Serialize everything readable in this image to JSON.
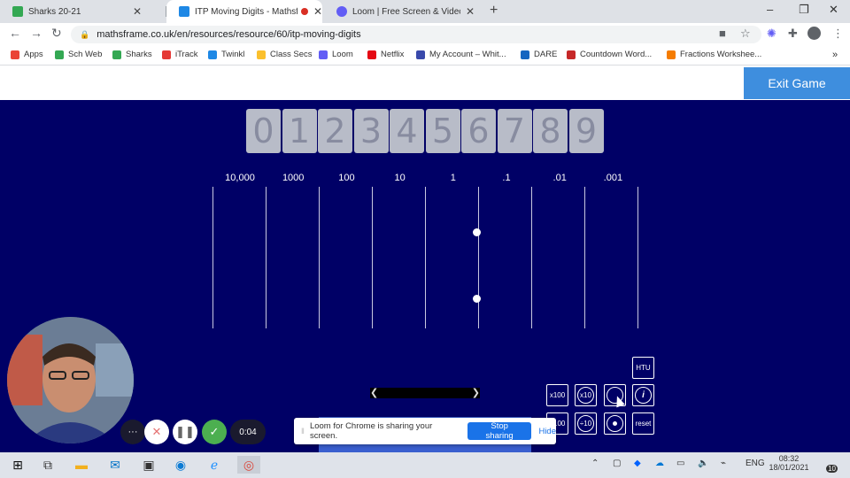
{
  "browser": {
    "tabs": [
      {
        "title": "Sharks 20-21",
        "active": false
      },
      {
        "title": "ITP Moving Digits - Mathsfr",
        "active": true
      },
      {
        "title": "Loom | Free Screen & Video Rec",
        "active": false
      }
    ],
    "new_tab": "+",
    "url": "mathsframe.co.uk/en/resources/resource/60/itp-moving-digits",
    "window_controls": {
      "minimize": "–",
      "restore": "❐",
      "close": "✕"
    }
  },
  "bookmarks": [
    {
      "label": "Apps",
      "color": "#ea4335"
    },
    {
      "label": "Sch Web",
      "color": "#34a853"
    },
    {
      "label": "Sharks",
      "color": "#34a853"
    },
    {
      "label": "iTrack",
      "color": "#e53935"
    },
    {
      "label": "Twinkl",
      "color": "#1e88e5"
    },
    {
      "label": "Class Secs",
      "color": "#fbc02d"
    },
    {
      "label": "Loom",
      "color": "#625df5"
    },
    {
      "label": "Netflix",
      "color": "#e50914"
    },
    {
      "label": "My Account – Whit...",
      "color": "#3949ab"
    },
    {
      "label": "DARE",
      "color": "#1565c0"
    },
    {
      "label": "Countdown Word...",
      "color": "#c62828"
    },
    {
      "label": "Fractions Workshee...",
      "color": "#f57c00"
    }
  ],
  "page": {
    "exit_label": "Exit Game"
  },
  "game": {
    "digits": [
      "0",
      "1",
      "2",
      "3",
      "4",
      "5",
      "6",
      "7",
      "8",
      "9"
    ],
    "place_values": [
      "10,000",
      "1000",
      "100",
      "10",
      "1",
      ".1",
      ".01",
      ".001"
    ],
    "controls": {
      "htu": "HTU",
      "x100": "x100",
      "x10": "x10",
      "info": "i",
      "div100": "÷100",
      "div10": "÷10",
      "reset": "reset"
    },
    "colors": {
      "background": "#000066",
      "tile": "#b8bcc8"
    }
  },
  "loom": {
    "timer": "0:04",
    "banner_text": "Loom for Chrome is sharing your screen.",
    "stop_label": "Stop sharing",
    "hide_label": "Hide"
  },
  "taskbar": {
    "language": "ENG",
    "time": "08:32",
    "date": "18/01/2021",
    "notifications": "10"
  }
}
